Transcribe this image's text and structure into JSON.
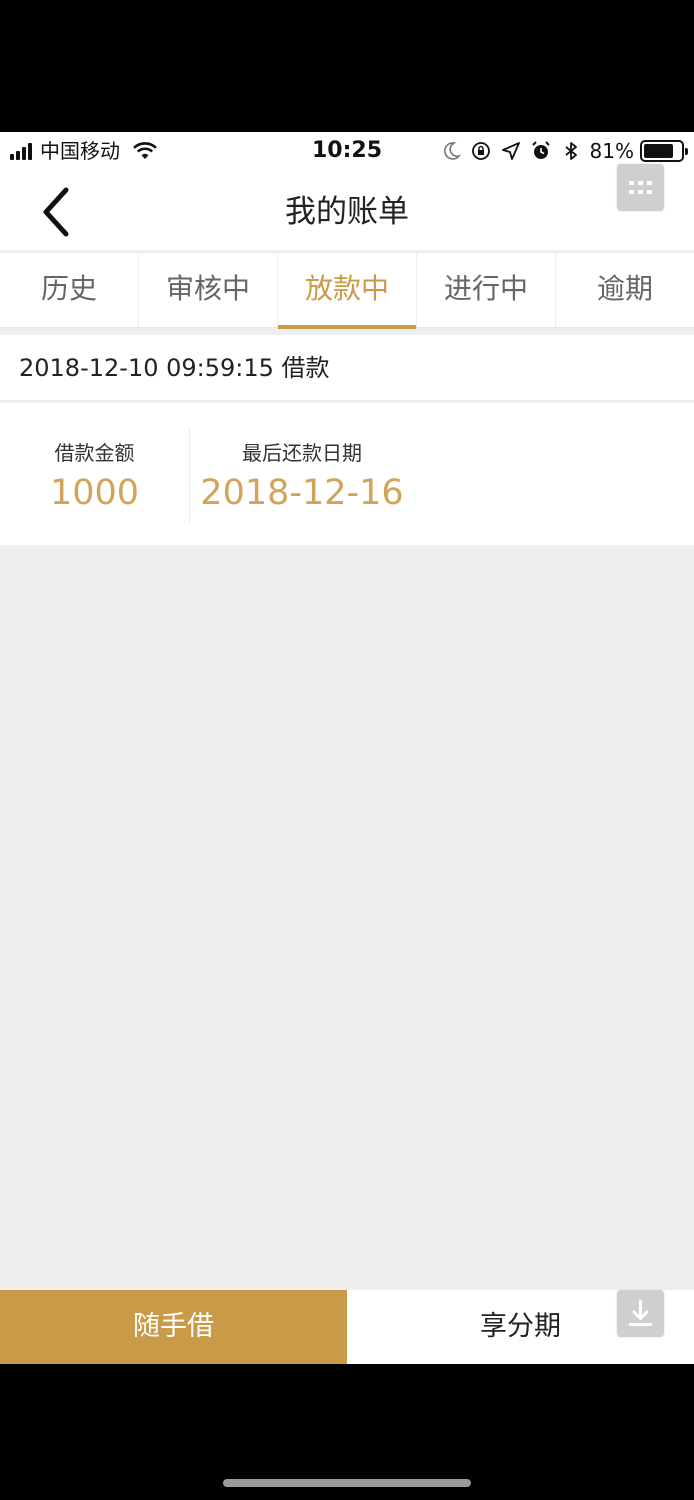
{
  "status_bar": {
    "carrier": "中国移动",
    "time": "10:25",
    "battery_percent": "81%",
    "battery_level": 0.81
  },
  "header": {
    "title": "我的账单",
    "back_icon": "chevron-left-icon",
    "menu_icon": "grid-icon"
  },
  "tabs": [
    {
      "label": "历史",
      "active": false
    },
    {
      "label": "审核中",
      "active": false
    },
    {
      "label": "放款中",
      "active": true
    },
    {
      "label": "进行中",
      "active": false
    },
    {
      "label": "逾期",
      "active": false
    }
  ],
  "bill": {
    "header": "2018-12-10 09:59:15 借款",
    "amount_label": "借款金额",
    "amount_value": "1000",
    "due_label": "最后还款日期",
    "due_value": "2018-12-16"
  },
  "bottom_bar": {
    "primary_label": "随手借",
    "secondary_label": "享分期",
    "download_icon": "download-icon"
  },
  "colors": {
    "accent": "#c99a47",
    "value_text": "#d2a45a",
    "background": "#efefef"
  }
}
